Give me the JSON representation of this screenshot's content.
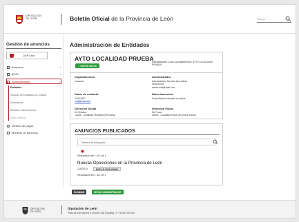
{
  "header": {
    "dip_line1": "DIPUTACIÓN",
    "dip_line2": "DE LEÓN",
    "title_bold": "Boletín Oficial",
    "title_rest": " de la Provincia de León",
    "search_placeholder": "Buscar"
  },
  "sidebar": {
    "title": "Gestión de anuncios",
    "user": "DOP León",
    "items": [
      {
        "label": "Anuncios",
        "plus": "+"
      },
      {
        "label": "BOPs",
        "plus": "+"
      },
      {
        "label": "Administración",
        "plus": "−"
      },
      {
        "label": "Gestión de pagos"
      },
      {
        "label": "Modelos de anuncios"
      }
    ],
    "subitems": [
      "Entidades",
      "Relación de Entidades por Entidad",
      "Estadísticas",
      "Boletines extraordinarios",
      "Nuevo anuncio"
    ]
  },
  "main": {
    "title": "Administración de Entidades",
    "entity": {
      "name": "AYTO LOCALIDAD PRUEBA",
      "edit_label": "✓ EDITAR DATOS",
      "breadcrumb": "Administración Local / Ayuntamientos / AYTO LOCALIDAD PRUEBA",
      "departamentos_label": "Departamentos",
      "departamentos_value": "anuncios",
      "admin_label": "Administrador",
      "admin_name": "Administrador Nombre Ape Admin",
      "admin_phone": "000000000",
      "admin_email": "admin.mail@mail.com",
      "contacto_label": "Datos de contacto",
      "contacto_phone": "111111897",
      "contacto_email": "mail@mail.com",
      "bancarios_label": "Datos bancarios",
      "bancarios_value": "Domiciliación bancaria no activa",
      "social_label": "Dirección Social",
      "social_line1": "Dir Entidad",
      "social_line2": "12345 - Localidad PRUEBA (Provincia)",
      "fiscal_label": "Dirección Fiscal",
      "fiscal_line1": "Dir Fiscal",
      "fiscal_line2": "00000 - Localidad Fiscal (Provincia Fiscal)"
    },
    "anuncios": {
      "title": "ANUNCIOS PUBLICADOS",
      "search_placeholder": "Término de búsqueda",
      "results_top": "Resultados del 1 al 1 de 1",
      "ann_title": "Nuevas Oposiciones en la Provincia de León",
      "ann_date": "11/8/2023",
      "ann_badge": "BOP-LE-2023-000000",
      "results_bottom": "Resultados del 1 al 1 de 1"
    },
    "btn_delete": "ELIMINAR",
    "btn_admin": "EDITAR ADMINISTRADOR"
  },
  "footer": {
    "dip_line1": "DIPUTACIÓN",
    "dip_line2": "DE LEÓN",
    "name": "Diputación de León",
    "address": "Plaza de San Marcelo 6 | 24002 León (España) | T. +34 987 292 100"
  }
}
